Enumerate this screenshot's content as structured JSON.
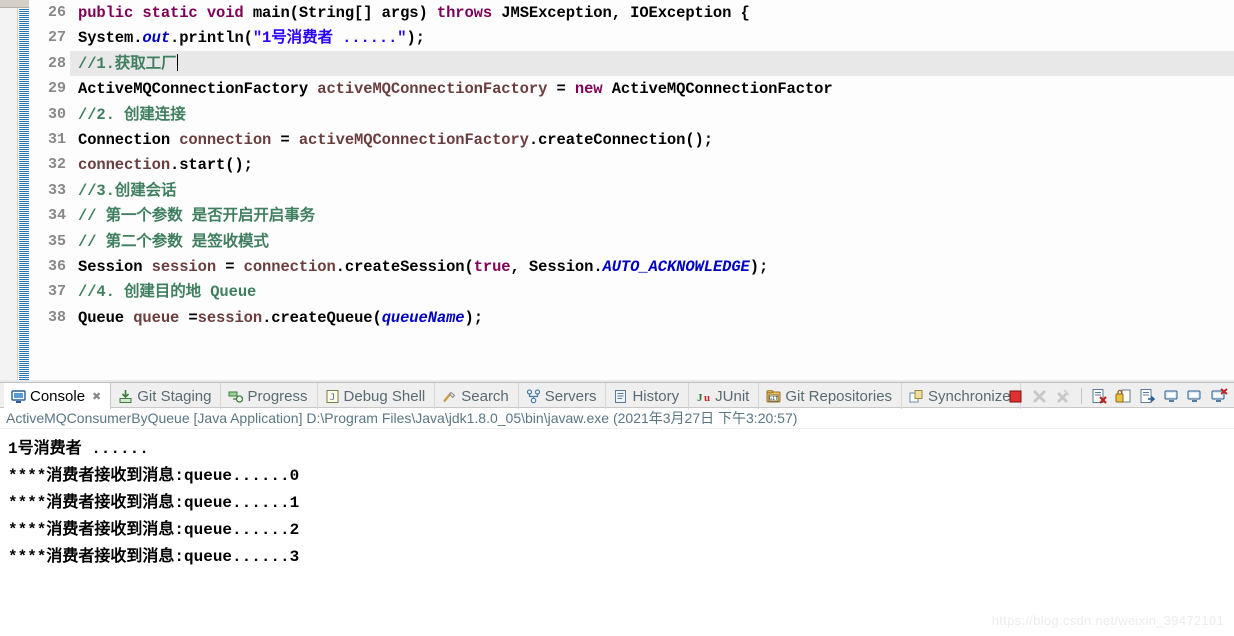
{
  "editor": {
    "lines": [
      {
        "num": "26",
        "fold": true,
        "current": false,
        "tokens": [
          {
            "t": "        ",
            "c": "pl"
          },
          {
            "t": "public static void ",
            "c": "k"
          },
          {
            "t": "main(String[] args) ",
            "c": "pl"
          },
          {
            "t": "throws ",
            "c": "k"
          },
          {
            "t": "JMSException, IOException {",
            "c": "pl"
          }
        ]
      },
      {
        "num": "27",
        "fold": false,
        "current": false,
        "tokens": [
          {
            "t": "            System.",
            "c": "pl"
          },
          {
            "t": "out",
            "c": "fld"
          },
          {
            "t": ".println(",
            "c": "pl"
          },
          {
            "t": "\"1号消费者 ......\"",
            "c": "s"
          },
          {
            "t": ");",
            "c": "pl"
          }
        ]
      },
      {
        "num": "28",
        "fold": false,
        "current": true,
        "caret": true,
        "tokens": [
          {
            "t": "            ",
            "c": "pl"
          },
          {
            "t": "//1.获取工厂",
            "c": "cm"
          }
        ]
      },
      {
        "num": "29",
        "fold": false,
        "current": false,
        "tokens": [
          {
            "t": "            ActiveMQConnectionFactory ",
            "c": "pl"
          },
          {
            "t": "activeMQConnectionFactory",
            "c": "id"
          },
          {
            "t": " = ",
            "c": "pl"
          },
          {
            "t": "new ",
            "c": "k"
          },
          {
            "t": "ActiveMQConnectionFactor",
            "c": "pl"
          }
        ]
      },
      {
        "num": "30",
        "fold": false,
        "current": false,
        "tokens": [
          {
            "t": "            ",
            "c": "pl"
          },
          {
            "t": "//2. 创建连接",
            "c": "cm"
          }
        ]
      },
      {
        "num": "31",
        "fold": false,
        "current": false,
        "tokens": [
          {
            "t": "            Connection ",
            "c": "pl"
          },
          {
            "t": "connection",
            "c": "id"
          },
          {
            "t": " = ",
            "c": "pl"
          },
          {
            "t": "activeMQConnectionFactory",
            "c": "id"
          },
          {
            "t": ".createConnection();",
            "c": "pl"
          }
        ]
      },
      {
        "num": "32",
        "fold": false,
        "current": false,
        "tokens": [
          {
            "t": "            ",
            "c": "pl"
          },
          {
            "t": "connection",
            "c": "id"
          },
          {
            "t": ".start();",
            "c": "pl"
          }
        ]
      },
      {
        "num": "33",
        "fold": false,
        "current": false,
        "tokens": [
          {
            "t": "            ",
            "c": "pl"
          },
          {
            "t": "//3.创建会话",
            "c": "cm"
          }
        ]
      },
      {
        "num": "34",
        "fold": false,
        "current": false,
        "tokens": [
          {
            "t": "            ",
            "c": "pl"
          },
          {
            "t": "//  第一个参数 是否开启开启事务",
            "c": "cm"
          }
        ]
      },
      {
        "num": "35",
        "fold": false,
        "current": false,
        "tokens": [
          {
            "t": "            ",
            "c": "pl"
          },
          {
            "t": "//  第二个参数 是签收模式",
            "c": "cm"
          }
        ]
      },
      {
        "num": "36",
        "fold": false,
        "current": false,
        "tokens": [
          {
            "t": "            Session ",
            "c": "pl"
          },
          {
            "t": "session",
            "c": "id"
          },
          {
            "t": " = ",
            "c": "pl"
          },
          {
            "t": "connection",
            "c": "id"
          },
          {
            "t": ".createSession(",
            "c": "pl"
          },
          {
            "t": "true",
            "c": "k"
          },
          {
            "t": ", Session.",
            "c": "pl"
          },
          {
            "t": "AUTO_ACKNOWLEDGE",
            "c": "fld"
          },
          {
            "t": ");",
            "c": "pl"
          }
        ]
      },
      {
        "num": "37",
        "fold": false,
        "current": false,
        "tokens": [
          {
            "t": "            ",
            "c": "pl"
          },
          {
            "t": "//4. 创建目的地 Queue",
            "c": "cm"
          }
        ]
      },
      {
        "num": "38",
        "fold": false,
        "current": false,
        "tokens": [
          {
            "t": "            Queue ",
            "c": "pl"
          },
          {
            "t": "queue",
            "c": "id"
          },
          {
            "t": " =",
            "c": "pl"
          },
          {
            "t": "session",
            "c": "id"
          },
          {
            "t": ".createQueue(",
            "c": "pl"
          },
          {
            "t": "queueName",
            "c": "fld"
          },
          {
            "t": ");",
            "c": "pl"
          }
        ]
      }
    ]
  },
  "console": {
    "tabs": [
      {
        "label": "Console",
        "icon": "console-icon",
        "active": true,
        "closable": true
      },
      {
        "label": "Git Staging",
        "icon": "git-staging-icon",
        "active": false,
        "closable": false
      },
      {
        "label": "Progress",
        "icon": "progress-icon",
        "active": false,
        "closable": false
      },
      {
        "label": "Debug Shell",
        "icon": "debug-shell-icon",
        "active": false,
        "closable": false
      },
      {
        "label": "Search",
        "icon": "search-icon",
        "active": false,
        "closable": false
      },
      {
        "label": "Servers",
        "icon": "servers-icon",
        "active": false,
        "closable": false
      },
      {
        "label": "History",
        "icon": "history-icon",
        "active": false,
        "closable": false
      },
      {
        "label": "JUnit",
        "icon": "junit-icon",
        "active": false,
        "closable": false
      },
      {
        "label": "Git Repositories",
        "icon": "git-repositories-icon",
        "active": false,
        "closable": false
      },
      {
        "label": "Synchronize",
        "icon": "synchronize-icon",
        "active": false,
        "closable": false
      }
    ],
    "toolbar": [
      {
        "name": "terminate-button",
        "enabled": true
      },
      {
        "name": "remove-launch-button",
        "enabled": false
      },
      {
        "name": "remove-all-launches-button",
        "enabled": false
      },
      {
        "name": "clear-console-button",
        "enabled": true
      },
      {
        "name": "scroll-lock-button",
        "enabled": true
      },
      {
        "name": "word-wrap-button",
        "enabled": true
      },
      {
        "name": "pin-console-button",
        "enabled": true
      },
      {
        "name": "display-selected-console-button",
        "enabled": true
      },
      {
        "name": "open-console-button",
        "enabled": true
      }
    ],
    "launch_line": "ActiveMQConsumerByQueue [Java Application] D:\\Program Files\\Java\\jdk1.8.0_05\\bin\\javaw.exe  (2021年3月27日 下午3:20:57)",
    "output": [
      "1号消费者 ......",
      "****消费者接收到消息:queue......0",
      "****消费者接收到消息:queue......1",
      "****消费者接收到消息:queue......2",
      "****消费者接收到消息:queue......3"
    ]
  },
  "watermark": {
    "text": "https://blog.csdn.net/weixin_39472101"
  },
  "colors": {
    "keyword": "#7F0055",
    "string": "#2A00FF",
    "comment": "#3F7F5F",
    "field": "#0000C0",
    "identifier": "#6A3E3E",
    "line_number": "#888888",
    "current_line_highlight": "#E8E8E8",
    "annotation_stripe": "#1D6FB0",
    "launch_line_text": "#5A7684"
  }
}
